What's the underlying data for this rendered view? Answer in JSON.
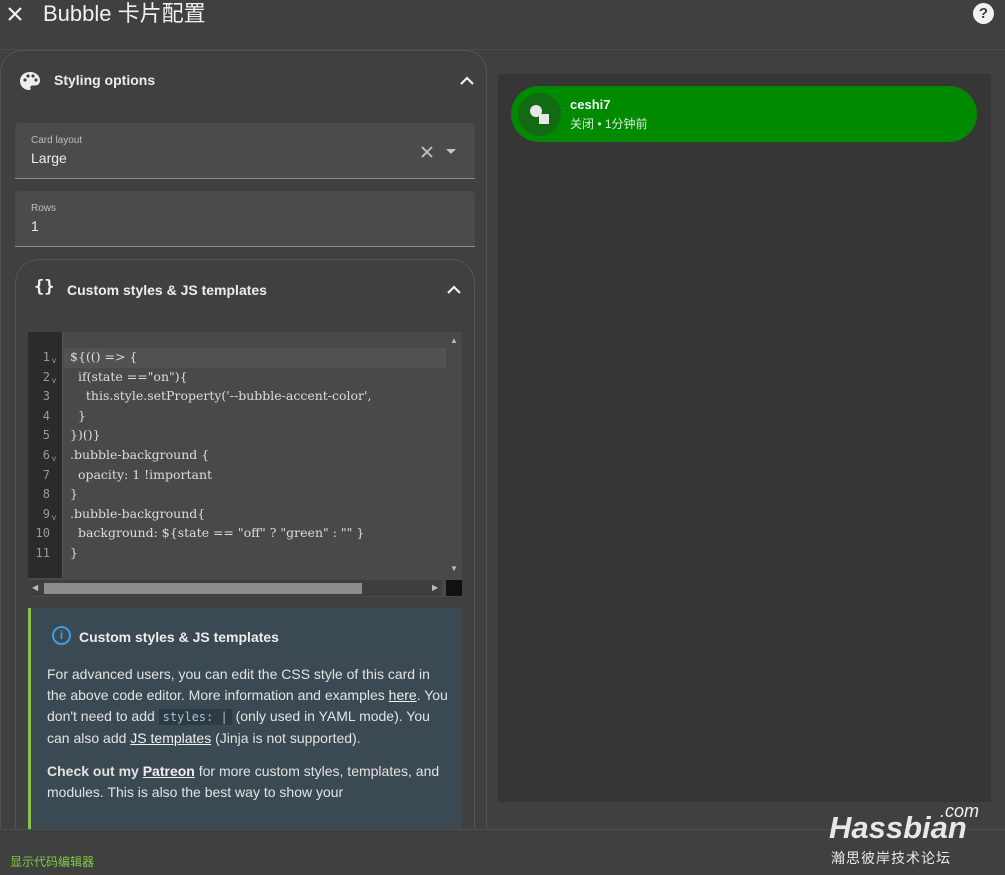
{
  "dialog": {
    "title": "Bubble 卡片配置",
    "close_icon": "close-icon",
    "help_icon": "help-icon",
    "help_label": "?"
  },
  "styling": {
    "section_title": "Styling options",
    "icon": "palette-icon",
    "card_layout": {
      "label": "Card layout",
      "value": "Large"
    },
    "rows": {
      "label": "Rows",
      "value": "1"
    }
  },
  "custom_styles": {
    "section_title": "Custom styles & JS templates",
    "icon_glyph": "{}",
    "code_lines": [
      "${(() => {",
      "  if(state ==\"on\"){",
      "    this.style.setProperty('--bubble-accent-color',",
      "  }",
      "})()}",
      ".bubble-background {",
      "  opacity: 1 !important",
      "}",
      ".bubble-background{",
      "  background: ${state == \"off\" ? \"green\" : \"\" }",
      "}"
    ],
    "line_numbers": [
      "1",
      "2",
      "3",
      "4",
      "5",
      "6",
      "7",
      "8",
      "9",
      "10",
      "11"
    ]
  },
  "info": {
    "title": "Custom styles & JS templates",
    "p1_a": "For advanced users, you can edit the CSS style of this card in the above code editor. More information and examples ",
    "p1_link_here": "here",
    "p1_b": ". You don't need to add ",
    "p1_code": "styles: |",
    "p1_c": " (only used in YAML mode). You can also add ",
    "p1_link_js": "JS templates",
    "p1_d": " (Jinja is not supported).",
    "p2_a": "Check out my ",
    "p2_link": "Patreon",
    "p2_b": " for more custom styles, templates, and modules. This is also the best way to show your"
  },
  "preview": {
    "entity_name": "ceshi7",
    "entity_state": "关闭 • 1分钟前",
    "accent_color": "#008a00"
  },
  "footer": {
    "show_code_label": "显示代码编辑器"
  },
  "watermark": {
    "com": ".com",
    "brand": "Hassbian",
    "subtitle": "瀚思彼岸技术论坛"
  }
}
